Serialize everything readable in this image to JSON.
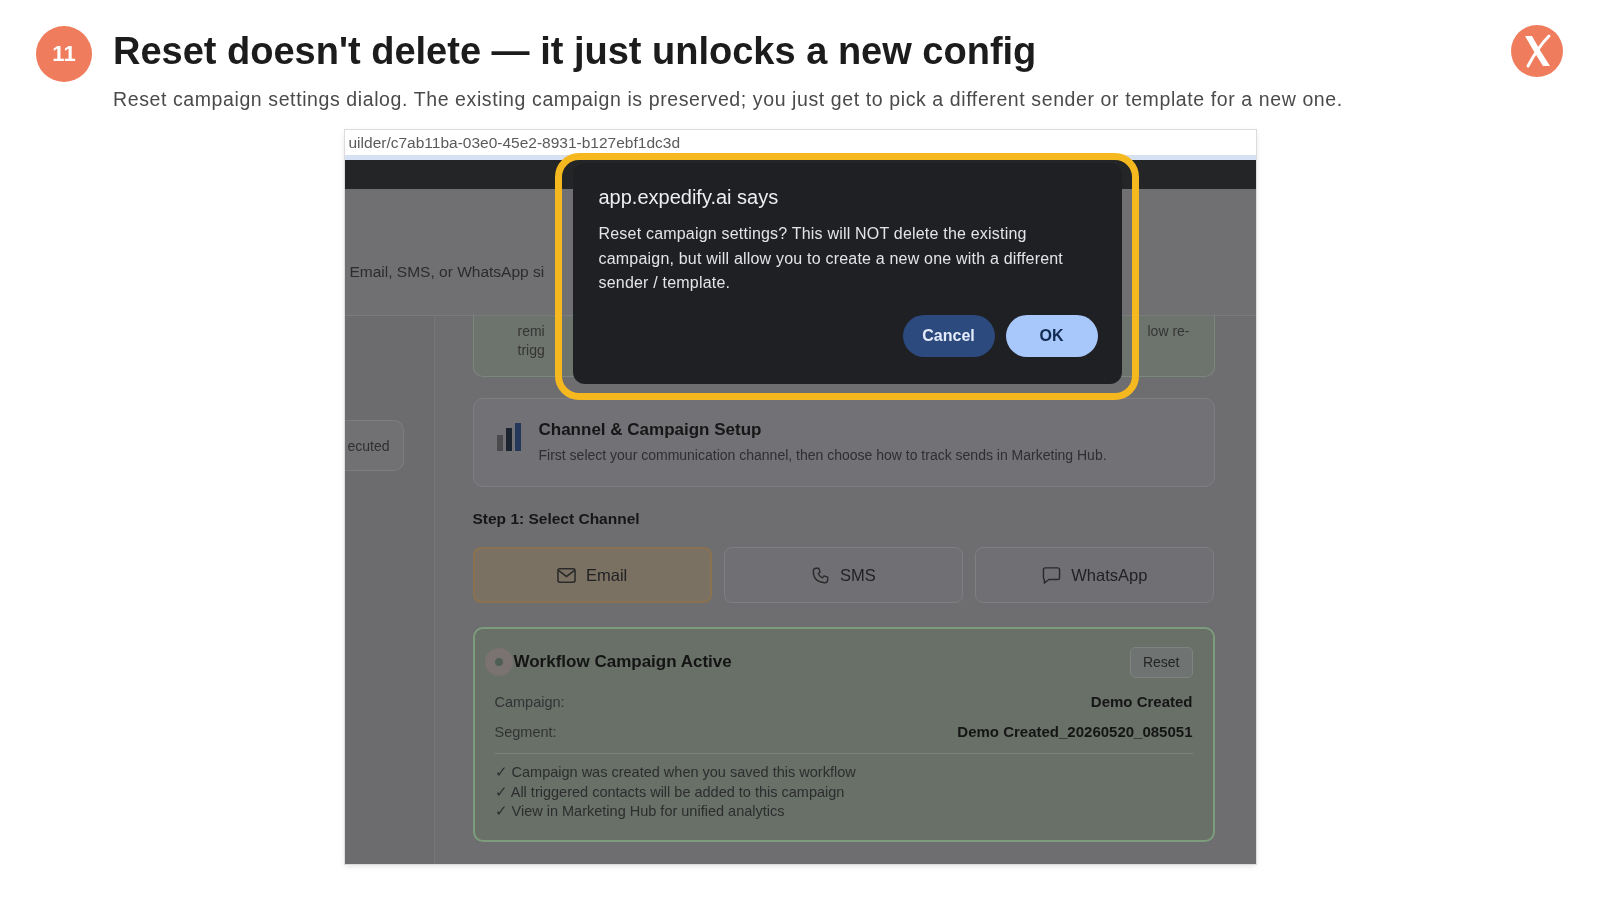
{
  "slide": {
    "step_number": "11",
    "title": "Reset doesn't delete — it just unlocks a new config",
    "subtitle": "Reset campaign settings dialog. The existing campaign is preserved; you just get to pick a different sender or template for a new one."
  },
  "screenshot": {
    "url": "uilder/c7ab11ba-03e0-45e2-8931-b127ebf1dc3d",
    "header_text": "Email, SMS, or WhatsApp si",
    "sidebar_chip": "ecuted",
    "partial_card": {
      "left_lines": [
        "remi",
        "trigg"
      ],
      "right_text": "low re-"
    },
    "setup_card": {
      "title": "Channel & Campaign Setup",
      "description": "First select your communication channel, then choose how to track sends in Marketing Hub."
    },
    "step_label": "Step 1: Select Channel",
    "channels": [
      {
        "label": "Email",
        "selected": true
      },
      {
        "label": "SMS",
        "selected": false
      },
      {
        "label": "WhatsApp",
        "selected": false
      }
    ],
    "campaign_card": {
      "title": "Workflow Campaign Active",
      "reset_button": "Reset",
      "fields": [
        {
          "label": "Campaign:",
          "value": "Demo Created"
        },
        {
          "label": "Segment:",
          "value": "Demo Created_20260520_085051"
        }
      ],
      "notes": [
        "✓ Campaign was created when you saved this workflow",
        "✓ All triggered contacts will be added to this campaign",
        "✓ View in Marketing Hub for unified analytics"
      ]
    },
    "dialog": {
      "title": "app.expedify.ai says",
      "message": "Reset campaign settings? This will NOT delete the existing campaign, but will allow you to create a new one with a different sender / template.",
      "buttons": [
        {
          "label": "Cancel",
          "kind": "secondary"
        },
        {
          "label": "OK",
          "kind": "primary"
        }
      ]
    }
  }
}
